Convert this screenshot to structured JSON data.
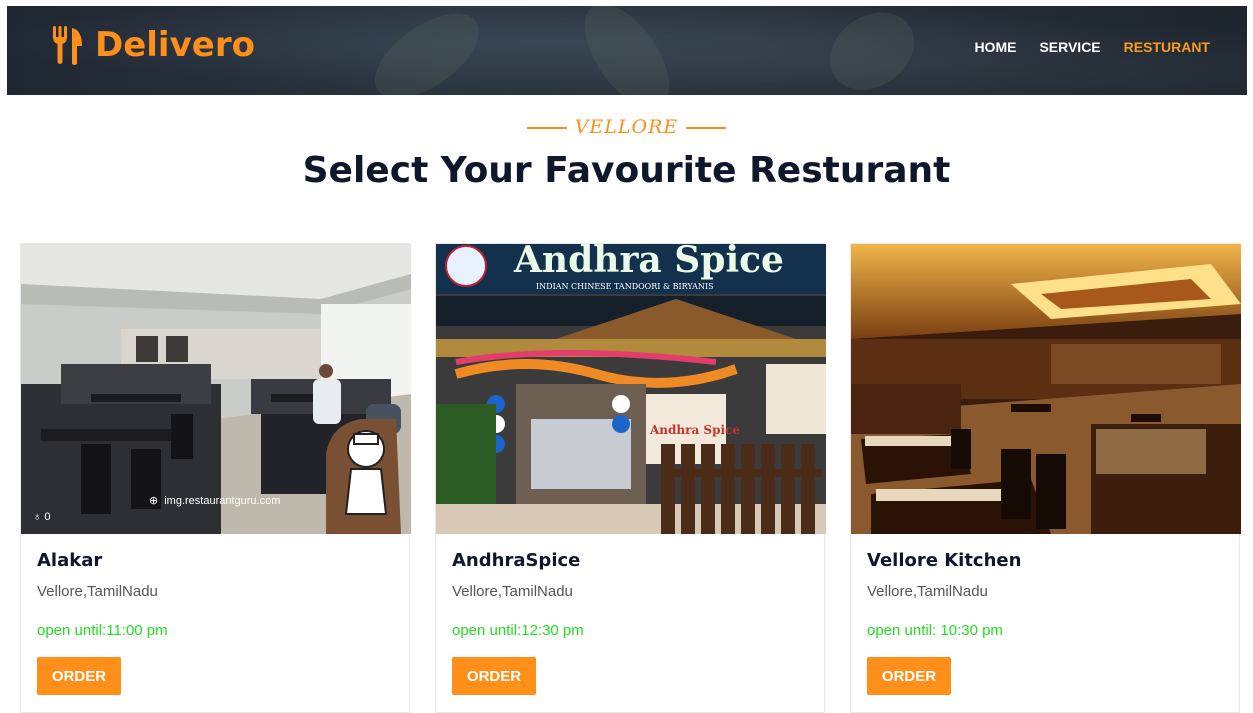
{
  "brand": {
    "name": "Delivero",
    "icon": "utensils-icon",
    "accent": "#fd8f1a"
  },
  "nav": {
    "items": [
      {
        "label": "HOME",
        "active": false
      },
      {
        "label": "SERVICE",
        "active": false
      },
      {
        "label": "RESTURANT",
        "active": true
      }
    ]
  },
  "section": {
    "tag": "VELLORE",
    "title": "Select Your Favourite Resturant"
  },
  "restaurants": [
    {
      "name": "Alakar",
      "location": "Vellore,TamilNadu",
      "hours": "open until:11:00 pm",
      "order_label": "ORDER",
      "photo_watermark": "img.restaurantguru.com",
      "photo_likes": "0"
    },
    {
      "name": "AndhraSpice",
      "location": "Vellore,TamilNadu",
      "hours": "open until:12:30 pm",
      "order_label": "ORDER",
      "sign_text": "Andhra Spice",
      "sign_subtext": "INDIAN CHINESE TANDOORI & BIRYANIS",
      "wall_text": "Andhra Spice"
    },
    {
      "name": "Vellore Kitchen",
      "location": "Vellore,TamilNadu",
      "hours": "open until: 10:30 pm",
      "order_label": "ORDER"
    }
  ]
}
